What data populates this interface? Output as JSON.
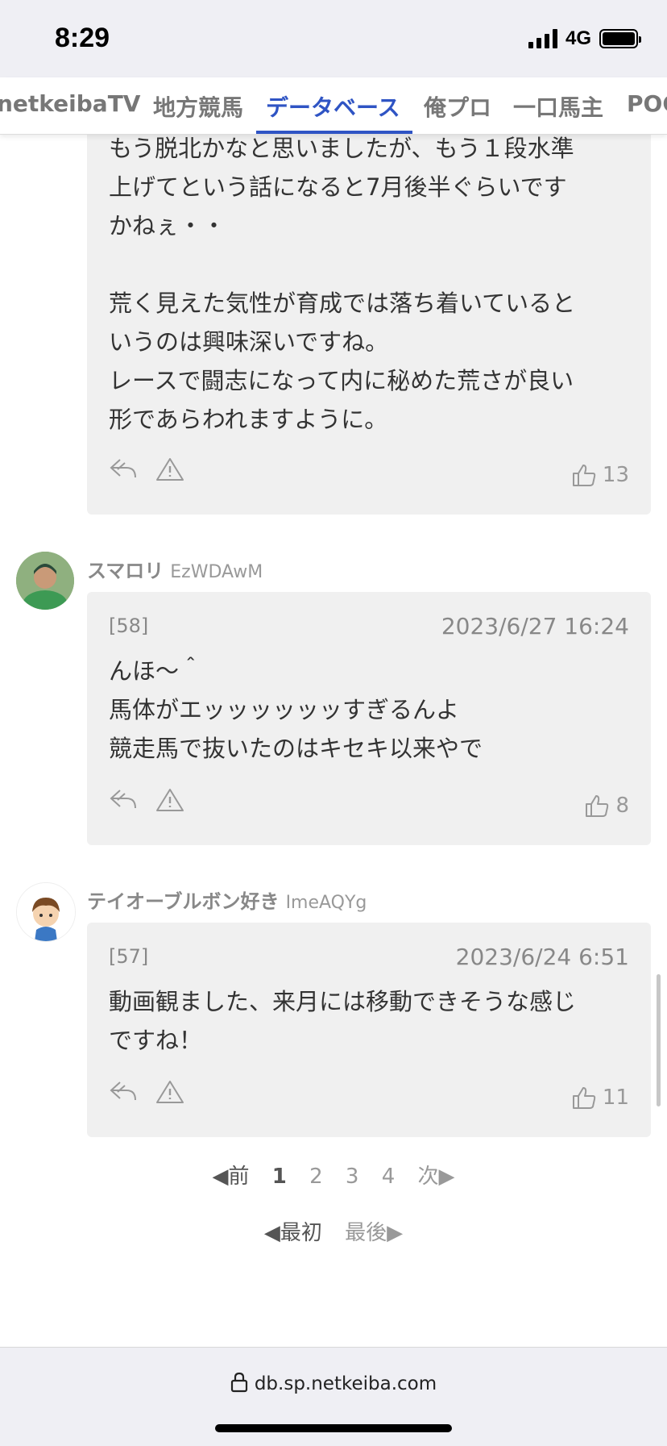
{
  "status": {
    "time": "8:29",
    "network": "4G"
  },
  "nav": {
    "tabs": [
      "netkeibaTV",
      "地方競馬",
      "データベース",
      "俺プロ",
      "一口馬主",
      "POG"
    ],
    "active": "データベース"
  },
  "comments": [
    {
      "body": "もう脱北かなと思いましたが、もう１段水準\n上げてという話になると7月後半ぐらいです\nかねぇ・・\n\n荒く見えた気性が育成では落ち着いていると\nいうのは興味深いですね。\nレースで闘志になって内に秘めた荒さが良い\n形であらわれますように。",
      "likes": "13"
    },
    {
      "user": "スマロリ",
      "user_id": "EzWDAwM",
      "number": "[58]",
      "date": "2023/6/27 16:24",
      "body": "んほ〜＾\n馬体がエッッッッッッすぎるんよ\n競走馬で抜いたのはキセキ以来やで",
      "likes": "8"
    },
    {
      "user": "テイオーブルボン好き",
      "user_id": "ImeAQYg",
      "number": "[57]",
      "date": "2023/6/24 6:51",
      "body": "動画観ました、来月には移動できそうな感じ\nですね！",
      "likes": "11"
    }
  ],
  "pager": {
    "prev": "◀前",
    "pages": [
      "1",
      "2",
      "3",
      "4"
    ],
    "current": "1",
    "next": "次▶",
    "first": "◀最初",
    "last": "最後▶"
  },
  "urlbar": {
    "url": "db.sp.netkeiba.com"
  },
  "colors": {
    "accent": "#2f54c4",
    "card_bg": "#f0f0f0"
  }
}
